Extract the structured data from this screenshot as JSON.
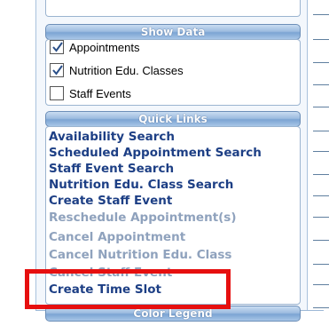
{
  "show_data": {
    "title": "Show Data",
    "options": [
      {
        "label": "Appointments",
        "checked": true
      },
      {
        "label": "Nutrition Edu. Classes",
        "checked": true
      },
      {
        "label": "Staff Events",
        "checked": false
      }
    ]
  },
  "quick_links": {
    "title": "Quick Links",
    "links": [
      {
        "label": "Availability Search",
        "enabled": true
      },
      {
        "label": "Scheduled Appointment Search",
        "enabled": true
      },
      {
        "label": "Staff Event Search",
        "enabled": true
      },
      {
        "label": "Nutrition Edu. Class Search",
        "enabled": true
      },
      {
        "label": "Create Staff Event",
        "enabled": true
      },
      {
        "label": "Reschedule Appointment(s)",
        "enabled": false
      },
      {
        "label": "Cancel Appointment",
        "enabled": false
      },
      {
        "label": "Cancel Nutrition Edu. Class",
        "enabled": false
      },
      {
        "label": "Cancel Staff Event",
        "enabled": false
      },
      {
        "label": "Create Time Slot",
        "enabled": true
      }
    ]
  },
  "color_legend": {
    "title": "Color Legend"
  },
  "colors": {
    "link_enabled": "#1d3f85",
    "link_disabled": "#8fa2bd",
    "highlight": "#e60f0f"
  }
}
